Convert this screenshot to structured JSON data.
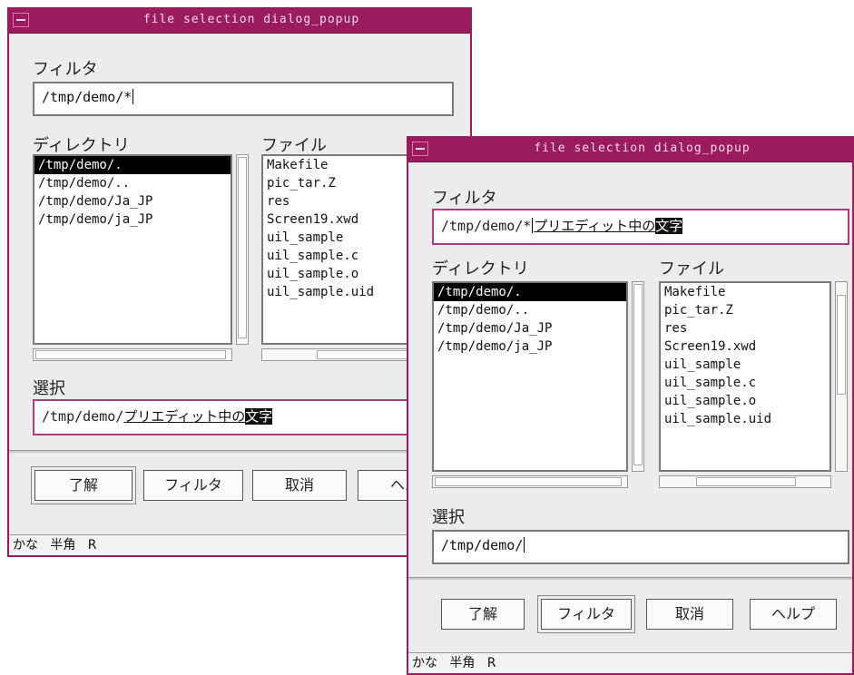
{
  "back_dialog": {
    "title": "file selection dialog_popup",
    "filter_label": "フィルタ",
    "filter_value": "/tmp/demo/*",
    "dir_label": "ディレクトリ",
    "file_label": "ファイル",
    "directories": [
      "/tmp/demo/.",
      "/tmp/demo/..",
      "/tmp/demo/Ja_JP",
      "/tmp/demo/ja_JP"
    ],
    "files": [
      "Makefile",
      "pic_tar.Z",
      "res",
      "Screen19.xwd",
      "uil_sample",
      "uil_sample.c",
      "uil_sample.o",
      "uil_sample.uid"
    ],
    "selection_label": "選択",
    "selection_prefix": "/tmp/demo/",
    "selection_preedit": "プリエディット中の",
    "selection_highlight": "文字",
    "buttons": {
      "ok": "了解",
      "filter": "フィルタ",
      "cancel": "取消",
      "help": "ヘル"
    },
    "status": {
      "kana": "かな",
      "halfwidth": "半角",
      "r": "R"
    }
  },
  "front_dialog": {
    "title": "file selection dialog_popup",
    "filter_label": "フィルタ",
    "filter_prefix": "/tmp/demo/*",
    "filter_preedit": "プリエディット中の",
    "filter_highlight": "文字",
    "dir_label": "ディレクトリ",
    "file_label": "ファイル",
    "directories": [
      "/tmp/demo/.",
      "/tmp/demo/..",
      "/tmp/demo/Ja_JP",
      "/tmp/demo/ja_JP"
    ],
    "files": [
      "Makefile",
      "pic_tar.Z",
      "res",
      "Screen19.xwd",
      "uil_sample",
      "uil_sample.c",
      "uil_sample.o",
      "uil_sample.uid"
    ],
    "selection_label": "選択",
    "selection_value": "/tmp/demo/",
    "buttons": {
      "ok": "了解",
      "filter": "フィルタ",
      "cancel": "取消",
      "help": "ヘルプ"
    },
    "status": {
      "kana": "かな",
      "halfwidth": "半角",
      "r": "R"
    }
  },
  "colors": {
    "titlebar": "#9b1b5f",
    "frame": "#9b1b5f",
    "dialog_bg": "#ececec"
  }
}
